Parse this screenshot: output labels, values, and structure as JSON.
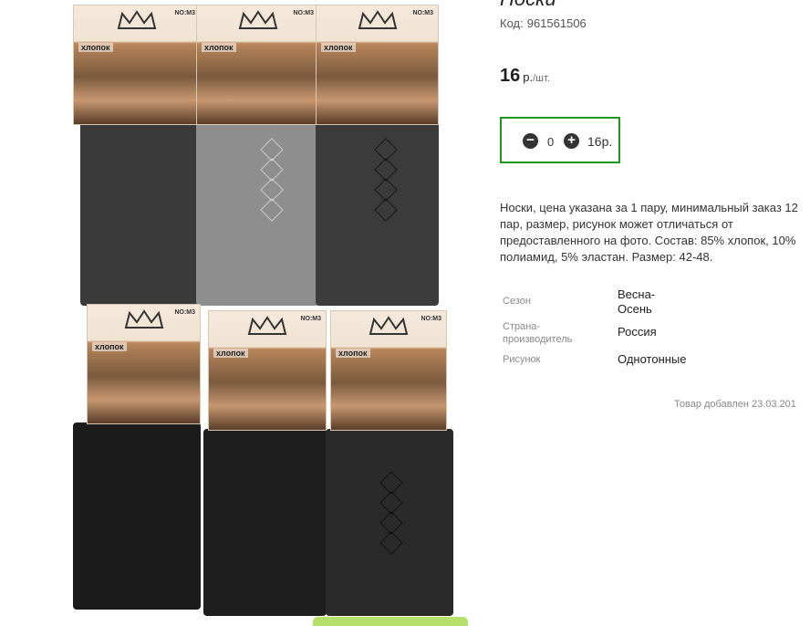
{
  "product": {
    "title": "Носки",
    "code_label": "Код:",
    "code_value": "961561506",
    "price_value": "16",
    "price_currency": "р.",
    "price_unit": "/шт."
  },
  "quantity": {
    "minus_symbol": "−",
    "plus_symbol": "+",
    "value": "0",
    "total": "16р."
  },
  "description": "Носки, цена указана за 1 пару, минимальный заказ 12 пар, размер, рисунок может отличаться от предоставленного на фото. Состав: 85% хлопок, 10% полиамид, 5% эластан. Размер: 42-48.",
  "properties": [
    {
      "key": "Сезон",
      "value": "Весна-Осень"
    },
    {
      "key": "Страна-производитель",
      "value": "Россия"
    },
    {
      "key": "Рисунок",
      "value": "Однотонные"
    }
  ],
  "added_text": "Товар добавлен 23.03.201",
  "image": {
    "card_brand": "хлопок",
    "card_no": "NO:M3",
    "sock_colors": [
      "#3a3a3a",
      "#8e8e8e",
      "#3b3b3b",
      "#1b1b1b",
      "#1e1e1e",
      "#2a2a2a"
    ],
    "accent_green": "#1a9a1a"
  }
}
